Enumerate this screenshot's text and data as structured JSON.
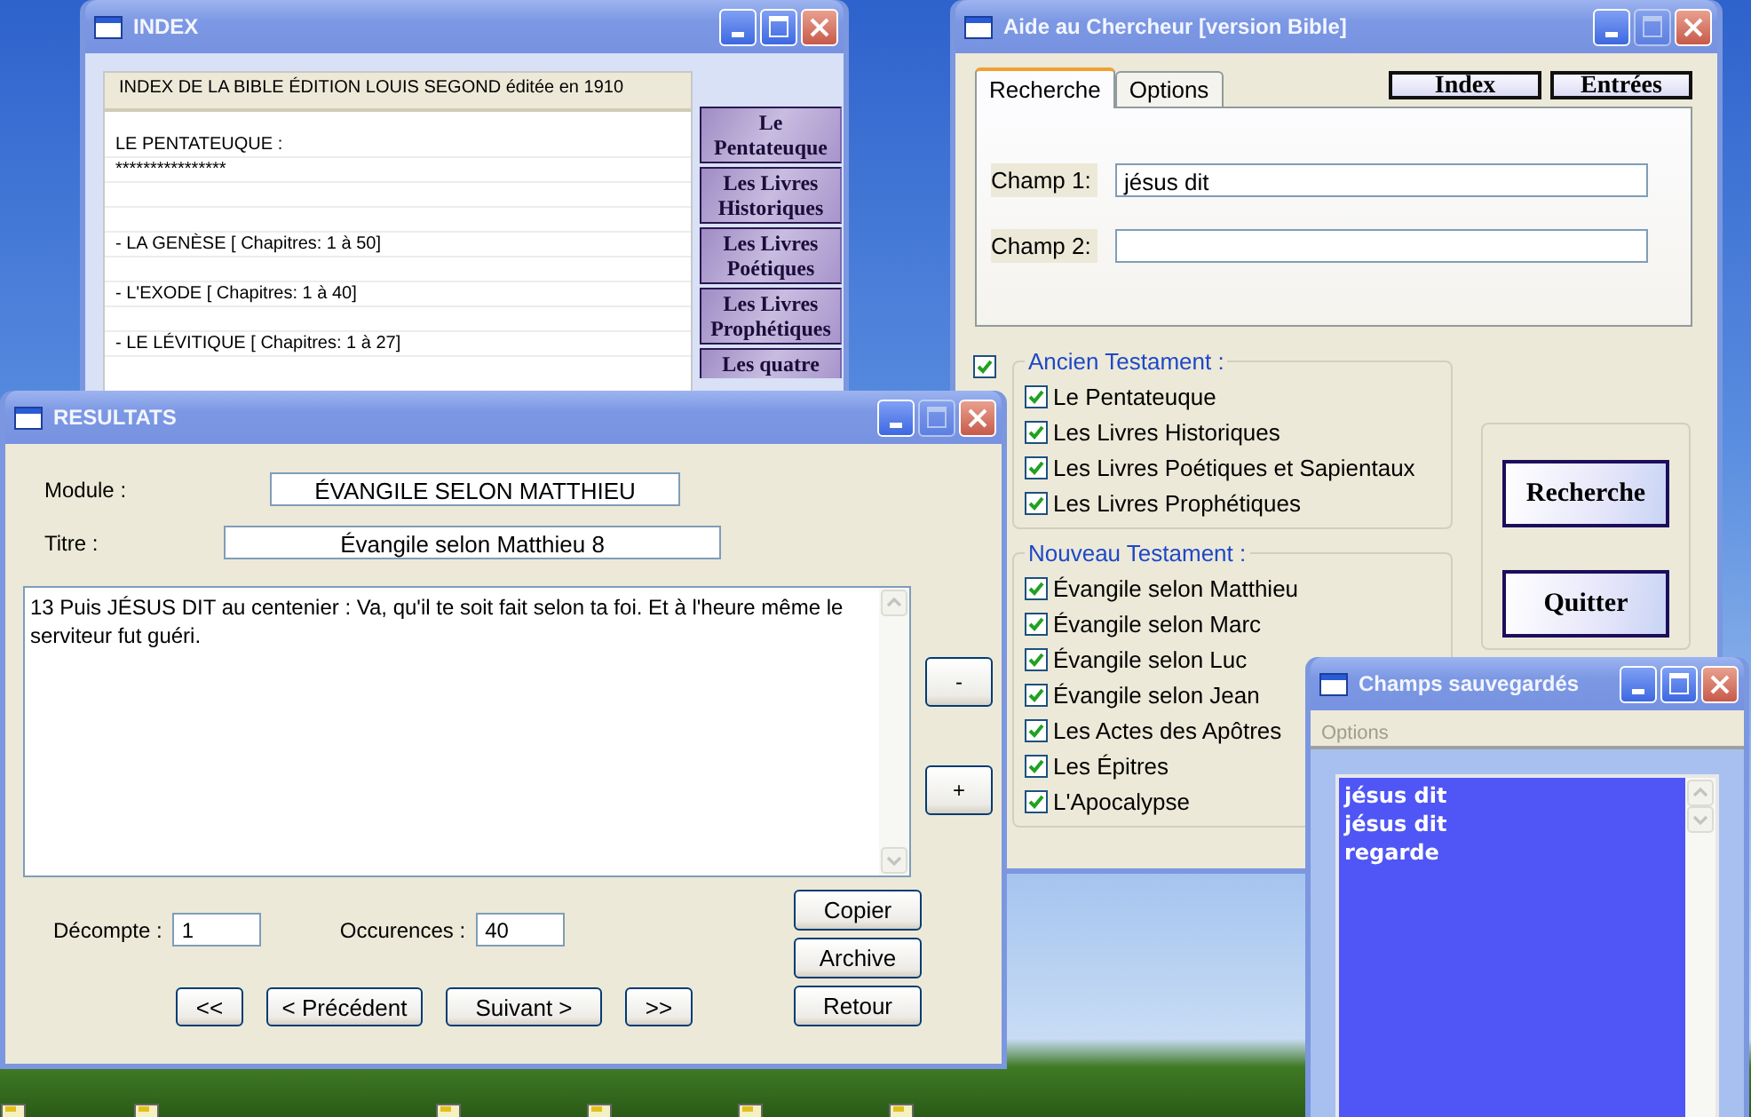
{
  "index_window": {
    "title": "INDEX",
    "maximize_disabled": false,
    "header": "INDEX DE LA BIBLE ÉDITION LOUIS SEGOND éditée en 1910",
    "lines": [
      {
        "kind": "heading",
        "text": "LE PENTATEUQUE :"
      },
      {
        "kind": "rule",
        "text": "****************"
      },
      {
        "kind": "entry",
        "text": "-  LA GENÈSE  [ Chapitres: 1 à 50]"
      },
      {
        "kind": "entry",
        "text": "-  L'EXODE  [ Chapitres: 1 à 40]"
      },
      {
        "kind": "entry",
        "text": "-  LE LÉVITIQUE  [ Chapitres: 1 à 27]"
      }
    ],
    "buttons": [
      "Le Pentateuque",
      "Les Livres Historiques",
      "Les Livres Poétiques",
      "Les Livres Prophétiques",
      "Les quatre"
    ]
  },
  "search_window": {
    "title": "Aide au Chercheur [version Bible]",
    "maximize_disabled": true,
    "tabs": [
      {
        "label": "Recherche",
        "selected": true
      },
      {
        "label": "Options",
        "selected": false
      }
    ],
    "top_buttons": [
      "Index",
      "Entrées"
    ],
    "fields": [
      {
        "label": "Champ 1:",
        "value": "jésus dit"
      },
      {
        "label": "Champ 2:"
      }
    ],
    "groups": [
      {
        "title": "Ancien Testament :",
        "checked": true,
        "items": [
          {
            "label": "Le Pentateuque",
            "checked": true
          },
          {
            "label": "Les Livres Historiques",
            "checked": true
          },
          {
            "label": "Les Livres Poétiques et Sapientaux",
            "checked": true
          },
          {
            "label": "Les Livres Prophétiques",
            "checked": true
          }
        ]
      },
      {
        "title": "Nouveau Testament :",
        "items": [
          {
            "label": "Évangile selon Matthieu",
            "checked": true
          },
          {
            "label": "Évangile selon Marc",
            "checked": true
          },
          {
            "label": "Évangile selon Luc",
            "checked": true
          },
          {
            "label": "Évangile selon Jean",
            "checked": true
          },
          {
            "label": "Les Actes des Apôtres",
            "checked": true
          },
          {
            "label": "Les Épitres",
            "checked": true
          },
          {
            "label": "L'Apocalypse",
            "checked": true
          }
        ]
      }
    ],
    "buttons": [
      "Recherche",
      "Quitter"
    ]
  },
  "results_window": {
    "title": "RESULTATS",
    "maximize_disabled": true,
    "module_label": "Module :",
    "module": "ÉVANGILE SELON MATTHIEU",
    "heading_label": "Titre :",
    "heading": "Évangile selon Matthieu 8",
    "text": "13 Puis JÉSUS DIT au centenier : Va, qu'il te soit fait selon ta foi. Et à l'heure même le serviteur fut guéri.",
    "zoom_buttons": [
      "-",
      "+"
    ],
    "count_label": "Décompte :",
    "count": "1",
    "occurrences_label": "Occurences :",
    "occurrences": "40",
    "nav_buttons": [
      "<<",
      "< Précédent",
      "Suivant >",
      ">>"
    ],
    "action_buttons": [
      "Copier",
      "Archive",
      "Retour"
    ]
  },
  "saved_window": {
    "title": "Champs sauvegardés",
    "maximize_disabled": false,
    "menu": [
      {
        "label": "Options",
        "disabled": true
      }
    ],
    "items": [
      "jésus dit",
      "jésus dit",
      "regarde"
    ]
  }
}
